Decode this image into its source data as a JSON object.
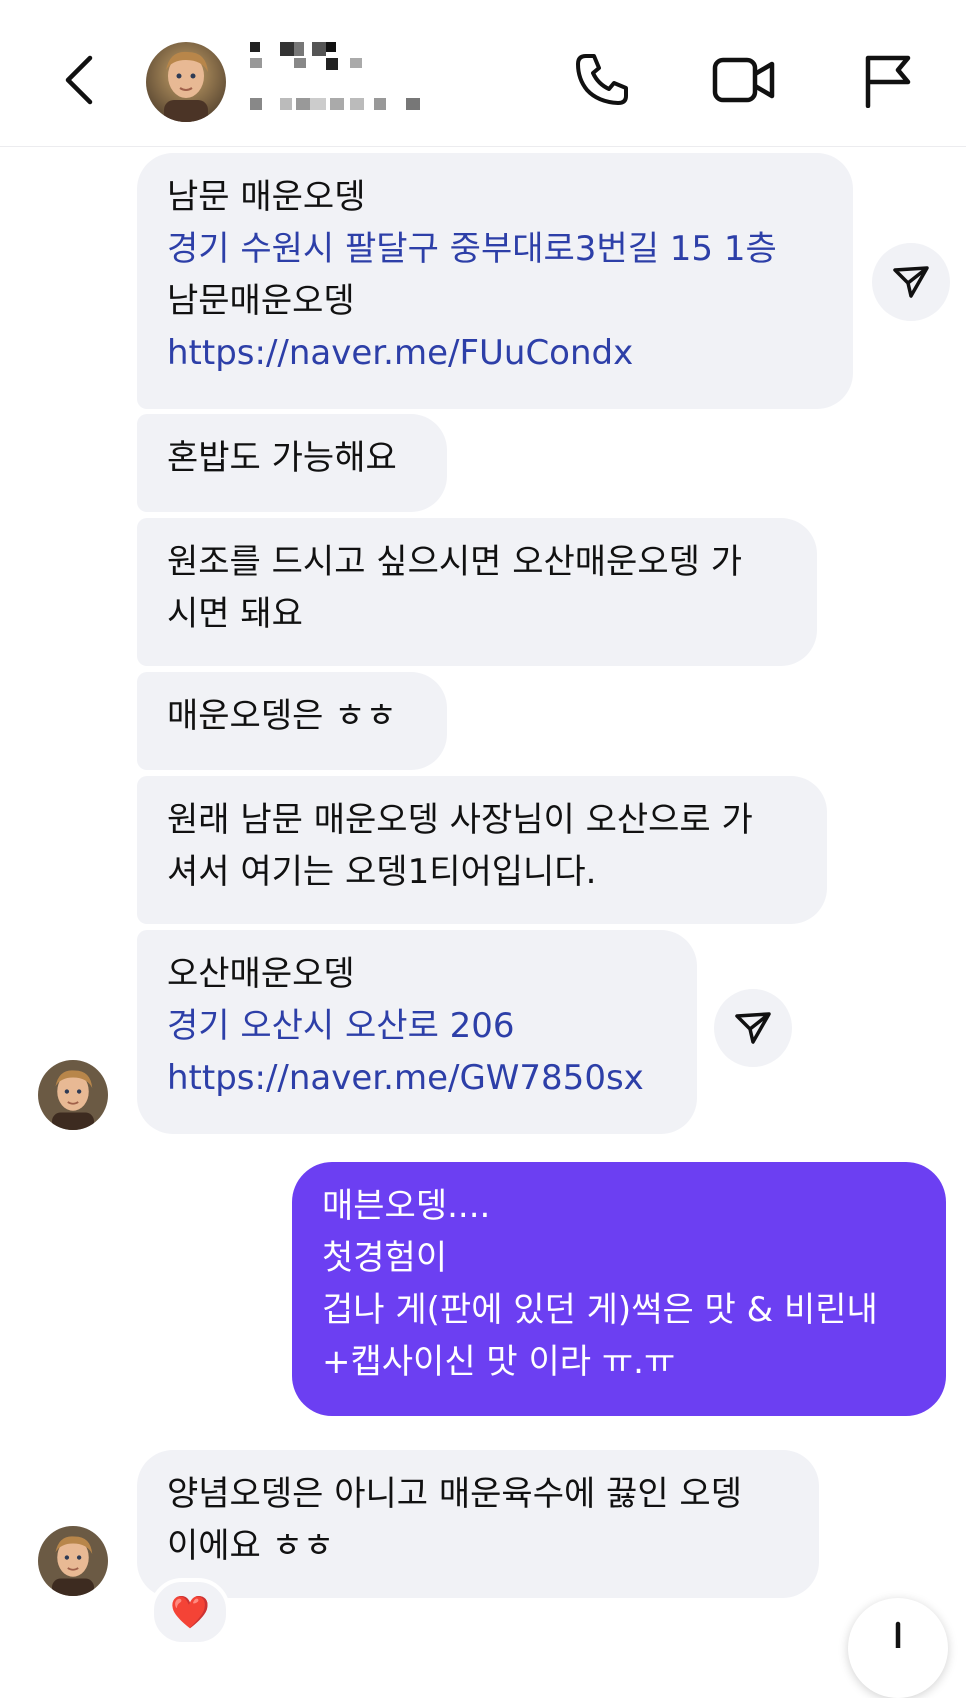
{
  "colors": {
    "incoming_bubble": "#f1f2f6",
    "outgoing_bubble": "#6c3ff2",
    "link": "#2d3fa8",
    "reaction_heart": "#e0142b"
  },
  "header": {
    "back_icon": "chevron-left-icon",
    "contact_name": "",
    "contact_subtitle": "",
    "name_pixelated": true,
    "actions": [
      "phone-icon",
      "video-camera-icon",
      "flag-icon"
    ]
  },
  "messages": [
    {
      "sender": "contact",
      "lines": [
        {
          "text": "남문 매운오뎅",
          "link": false
        },
        {
          "text": "경기 수원시 팔달구 중부대로3번길 15 1층",
          "link": true
        },
        {
          "text": "남문매운오뎅",
          "link": false
        },
        {
          "text": "https://naver.me/FUuCondx",
          "link": true
        }
      ],
      "share_icon": "send-icon"
    },
    {
      "sender": "contact",
      "lines": [
        {
          "text": "혼밥도 가능해요",
          "link": false
        }
      ]
    },
    {
      "sender": "contact",
      "lines": [
        {
          "text": "원조를 드시고 싶으시면 오산매운오뎅 가",
          "link": false
        },
        {
          "text": "시면 돼요",
          "link": false
        }
      ]
    },
    {
      "sender": "contact",
      "lines": [
        {
          "text": "매운오뎅은 ㅎㅎ",
          "link": false
        }
      ]
    },
    {
      "sender": "contact",
      "lines": [
        {
          "text": "원래 남문 매운오뎅 사장님이 오산으로 가",
          "link": false
        },
        {
          "text": "셔서 여기는 오뎅1티어입니다.",
          "link": false
        }
      ]
    },
    {
      "sender": "contact",
      "lines": [
        {
          "text": "오산매운오뎅",
          "link": false
        },
        {
          "text": "경기 오산시 오산로 206",
          "link": true
        },
        {
          "text": "https://naver.me/GW7850sx",
          "link": true
        }
      ],
      "share_icon": "send-icon"
    },
    {
      "sender": "me",
      "lines": [
        {
          "text": "매븐오뎅....",
          "link": false
        },
        {
          "text": "첫경험이",
          "link": false
        },
        {
          "text": "겁나 게(판에 있던 게)썩은 맛 & 비린내",
          "link": false
        },
        {
          "text": "+캡사이신 맛 이라 ㅠ.ㅠ",
          "link": false
        }
      ]
    },
    {
      "sender": "contact",
      "lines": [
        {
          "text": "양념오뎅은 아니고 매운육수에 끓인 오뎅",
          "link": false
        },
        {
          "text": "이에요 ㅎㅎ",
          "link": false
        }
      ],
      "reaction": "❤️"
    }
  ],
  "scroll_button_icon": "arrow-down-icon"
}
